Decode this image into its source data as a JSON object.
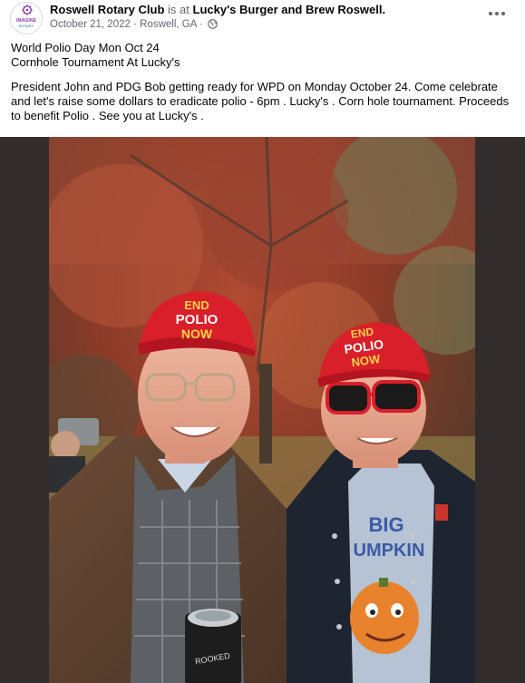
{
  "post": {
    "author": "Roswell Rotary Club",
    "is_at": "is at",
    "location": "Lucky's Burger and Brew Roswell.",
    "date": "October 21, 2022",
    "separator": "·",
    "city": "Roswell, GA",
    "privacy_icon": "globe-icon",
    "more_icon": "more-options-icon",
    "avatar": {
      "line1": "IMAGINE",
      "line2": "ROTARY",
      "accent": "#8e3aa6"
    },
    "caption": {
      "line1": "World Polio Day Mon Oct 24",
      "line2": "Cornhole Tournament At Lucky's",
      "body": "President John and PDG Bob getting ready for WPD on Monday October 24. Come celebrate and let's raise some dollars to eradicate polio - 6pm . Lucky's . Corn hole tournament. Proceeds to benefit Polio . See you at Lucky's ."
    },
    "photo": {
      "left_hat": {
        "line1": "END",
        "line2": "POLIO",
        "line3": "NOW"
      },
      "right_hat": {
        "line1": "END",
        "line2": "POLIO",
        "line3": "NOW"
      },
      "can_sleeve_text": "ROOKED",
      "shirt_text": {
        "line1": "BIG",
        "line2": "UMPKIN"
      }
    }
  },
  "colors": {
    "hat_red": "#d81f2a",
    "hat_text": "#f4d34a",
    "meta_gray": "#65676b",
    "photo_frame": "#322c2c"
  }
}
